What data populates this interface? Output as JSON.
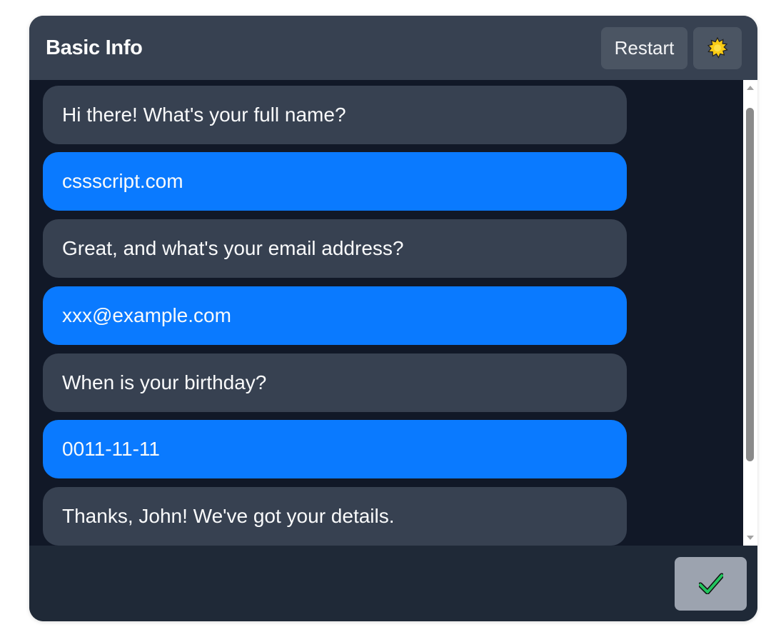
{
  "header": {
    "title": "Basic Info",
    "restart_label": "Restart",
    "theme_icon": "sun-icon"
  },
  "conversation": [
    {
      "role": "bot",
      "text": "Hi there! What's your full name?"
    },
    {
      "role": "user",
      "text": "cssscript.com"
    },
    {
      "role": "bot",
      "text": "Great, and what's your email address?"
    },
    {
      "role": "user",
      "text": "xxx@example.com"
    },
    {
      "role": "bot",
      "text": "When is your birthday?"
    },
    {
      "role": "user",
      "text": "0011-11-11"
    },
    {
      "role": "bot",
      "text": "Thanks, John! We've got your details."
    }
  ],
  "footer": {
    "submit_icon": "checkmark-icon"
  },
  "colors": {
    "header_bg": "#374151",
    "messages_bg": "#111827",
    "footer_bg": "#1f2937",
    "bot_bubble": "#374151",
    "user_bubble": "#0a7aff",
    "submit_button": "#9ca3af"
  }
}
